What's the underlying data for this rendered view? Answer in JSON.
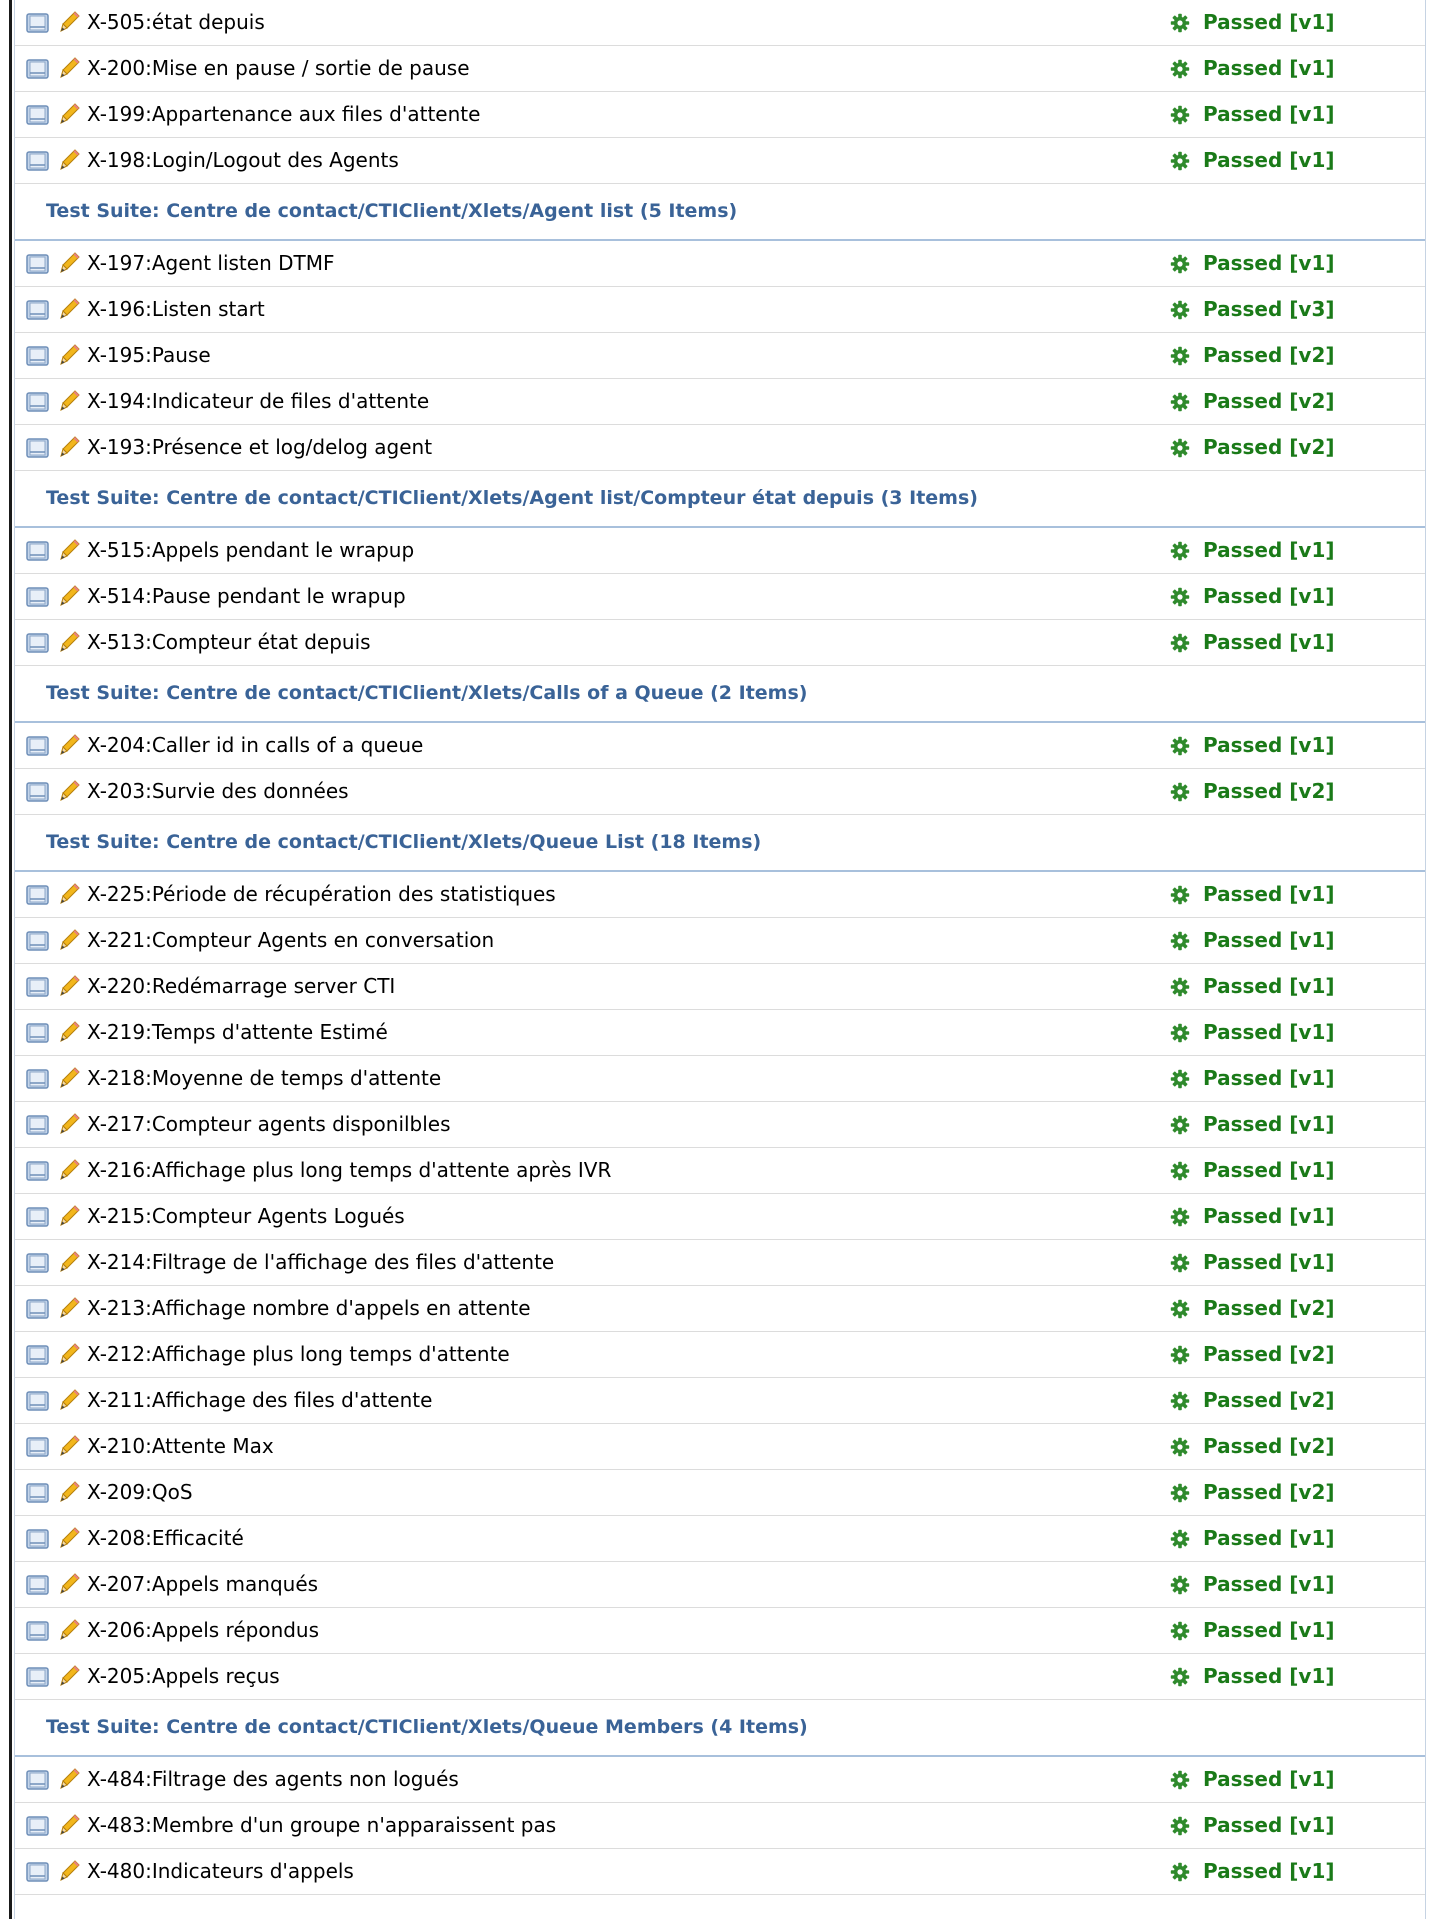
{
  "status_color": "#1a7a18",
  "suite_title_color": "#3a6397",
  "icons": {
    "row_primary": "notebook-icon",
    "row_secondary": "pencil-icon",
    "status": "gear-icon"
  },
  "groups": [
    {
      "suite": null,
      "cases": [
        {
          "name": "X-505:état depuis",
          "status": "Passed [v1]"
        },
        {
          "name": "X-200:Mise en pause / sortie de pause",
          "status": "Passed [v1]"
        },
        {
          "name": "X-199:Appartenance aux files d'attente",
          "status": "Passed [v1]"
        },
        {
          "name": "X-198:Login/Logout des Agents",
          "status": "Passed [v1]"
        }
      ]
    },
    {
      "suite": "Test Suite: Centre de contact/CTIClient/Xlets/Agent list (5 Items)",
      "cases": [
        {
          "name": "X-197:Agent listen DTMF",
          "status": "Passed [v1]"
        },
        {
          "name": "X-196:Listen start",
          "status": "Passed [v3]"
        },
        {
          "name": "X-195:Pause",
          "status": "Passed [v2]"
        },
        {
          "name": "X-194:Indicateur de files d'attente",
          "status": "Passed [v2]"
        },
        {
          "name": "X-193:Présence et log/delog agent",
          "status": "Passed [v2]"
        }
      ]
    },
    {
      "suite": "Test Suite: Centre de contact/CTIClient/Xlets/Agent list/Compteur état depuis (3 Items)",
      "cases": [
        {
          "name": "X-515:Appels pendant le wrapup",
          "status": "Passed [v1]"
        },
        {
          "name": "X-514:Pause pendant le wrapup",
          "status": "Passed [v1]"
        },
        {
          "name": "X-513:Compteur état depuis",
          "status": "Passed [v1]"
        }
      ]
    },
    {
      "suite": "Test Suite: Centre de contact/CTIClient/Xlets/Calls of a Queue (2 Items)",
      "cases": [
        {
          "name": "X-204:Caller id in calls of a queue",
          "status": "Passed [v1]"
        },
        {
          "name": "X-203:Survie des données",
          "status": "Passed [v2]"
        }
      ]
    },
    {
      "suite": "Test Suite: Centre de contact/CTIClient/Xlets/Queue List (18 Items)",
      "cases": [
        {
          "name": "X-225:Période de récupération des statistiques",
          "status": "Passed [v1]"
        },
        {
          "name": "X-221:Compteur Agents en conversation",
          "status": "Passed [v1]"
        },
        {
          "name": "X-220:Redémarrage server CTI",
          "status": "Passed [v1]"
        },
        {
          "name": "X-219:Temps d'attente Estimé",
          "status": "Passed [v1]"
        },
        {
          "name": "X-218:Moyenne de temps d'attente",
          "status": "Passed [v1]"
        },
        {
          "name": "X-217:Compteur agents disponilbles",
          "status": "Passed [v1]"
        },
        {
          "name": "X-216:Affichage plus long temps d'attente après IVR",
          "status": "Passed [v1]"
        },
        {
          "name": "X-215:Compteur Agents Logués",
          "status": "Passed [v1]"
        },
        {
          "name": "X-214:Filtrage de l'affichage des files d'attente",
          "status": "Passed [v1]"
        },
        {
          "name": "X-213:Affichage nombre d'appels en attente",
          "status": "Passed [v2]"
        },
        {
          "name": "X-212:Affichage plus long temps d'attente",
          "status": "Passed [v2]"
        },
        {
          "name": "X-211:Affichage des files d'attente",
          "status": "Passed [v2]"
        },
        {
          "name": "X-210:Attente Max",
          "status": "Passed [v2]"
        },
        {
          "name": "X-209:QoS",
          "status": "Passed [v2]"
        },
        {
          "name": "X-208:Efficacité",
          "status": "Passed [v1]"
        },
        {
          "name": "X-207:Appels manqués",
          "status": "Passed [v1]"
        },
        {
          "name": "X-206:Appels répondus",
          "status": "Passed [v1]"
        },
        {
          "name": "X-205:Appels reçus",
          "status": "Passed [v1]"
        }
      ]
    },
    {
      "suite": "Test Suite: Centre de contact/CTIClient/Xlets/Queue Members (4 Items)",
      "cases": [
        {
          "name": "X-484:Filtrage des agents non logués",
          "status": "Passed [v1]"
        },
        {
          "name": "X-483:Membre d'un groupe n'apparaissent pas",
          "status": "Passed [v1]"
        },
        {
          "name": "X-480:Indicateurs d'appels",
          "status": "Passed [v1]"
        }
      ]
    }
  ]
}
